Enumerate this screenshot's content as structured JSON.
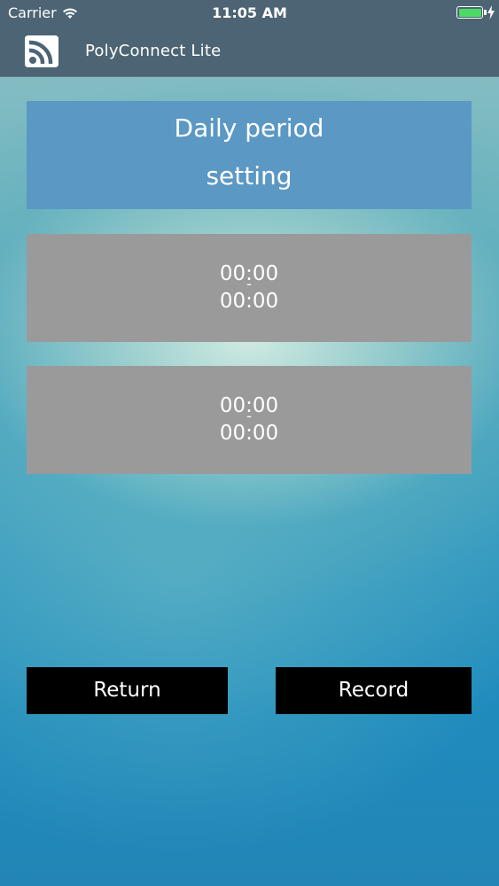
{
  "status_bar": {
    "carrier": "Carrier",
    "time": "11:05 AM",
    "battery_color": "#4cd964"
  },
  "nav_bar": {
    "logo_icon": "rss-feed-icon",
    "title": "PolyConnect Lite"
  },
  "header": {
    "line1": "Daily period",
    "line2": "setting"
  },
  "periods": [
    {
      "start": "00:00",
      "separator": "-",
      "end": "00:00"
    },
    {
      "start": "00:00",
      "separator": "-",
      "end": "00:00"
    }
  ],
  "buttons": {
    "return_label": "Return",
    "record_label": "Record"
  },
  "colors": {
    "nav_bg": "#4c6473",
    "header_bg": "#5b98c4",
    "period_bg": "#9b9a9b",
    "button_bg": "#000000"
  }
}
